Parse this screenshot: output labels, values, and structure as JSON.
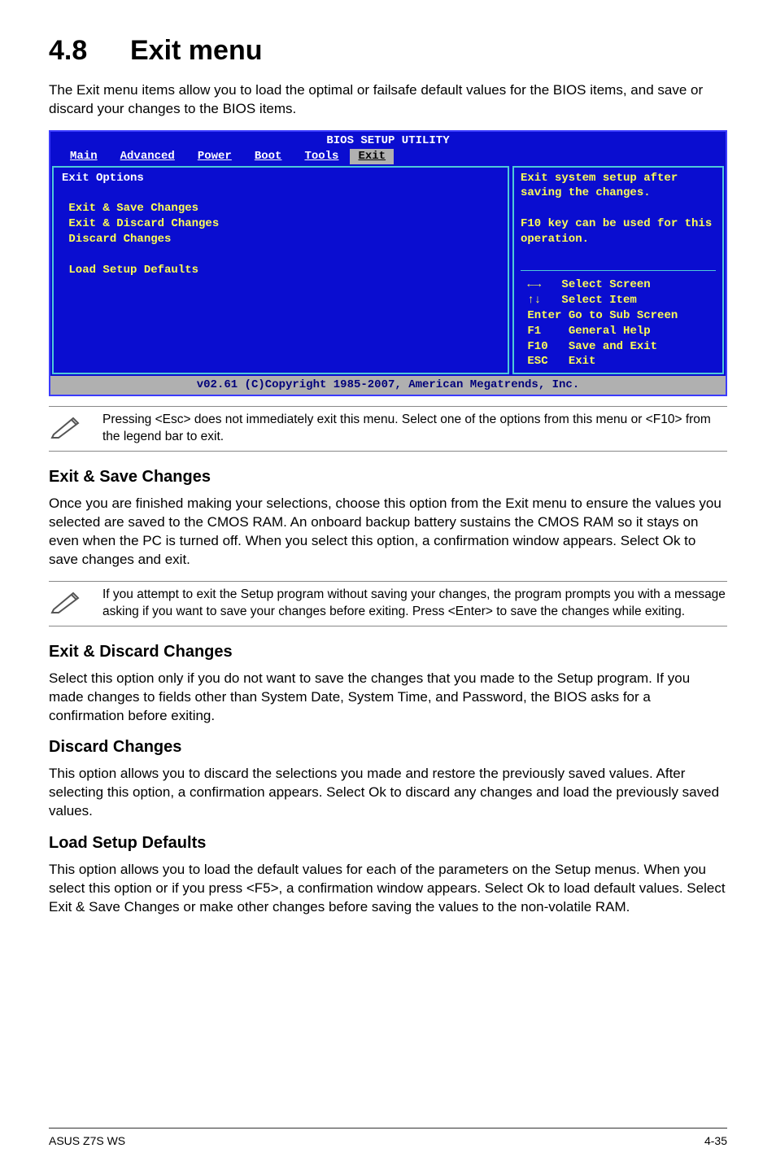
{
  "heading": {
    "number": "4.8",
    "title": "Exit menu"
  },
  "intro": "The Exit menu items allow you to load the optimal or failsafe default values for the BIOS items, and save or discard your changes to the BIOS items.",
  "bios": {
    "title": "BIOS SETUP UTILITY",
    "tabs": [
      "Main",
      "Advanced",
      "Power",
      "Boot",
      "Tools",
      "Exit"
    ],
    "active_tab": "Exit",
    "left": {
      "heading": "Exit Options",
      "items": [
        "Exit & Save Changes",
        "Exit & Discard Changes",
        "Discard Changes",
        "",
        "Load Setup Defaults"
      ]
    },
    "right": {
      "help1": "Exit system setup after saving the changes.",
      "help2": "F10 key can be used for this operation.",
      "hints": [
        {
          "key": "←→",
          "text": "Select Screen"
        },
        {
          "key": "↑↓",
          "text": "Select Item"
        },
        {
          "key": "Enter",
          "text": "Go to Sub Screen"
        },
        {
          "key": "F1",
          "text": "General Help"
        },
        {
          "key": "F10",
          "text": "Save and Exit"
        },
        {
          "key": "ESC",
          "text": "Exit"
        }
      ]
    },
    "footer": "v02.61 (C)Copyright 1985-2007, American Megatrends, Inc."
  },
  "note1": "Pressing <Esc> does not immediately exit this menu. Select one of the options from this menu or <F10> from the legend bar to exit.",
  "sections": {
    "s1": {
      "title": "Exit & Save Changes",
      "body": "Once you are finished making your selections, choose this option from the Exit menu to ensure the values you selected are saved to the CMOS RAM. An onboard backup battery sustains the CMOS RAM so it stays on even when the PC is turned off. When you select this option, a confirmation window appears. Select Ok to save changes and exit."
    },
    "note2": "If you attempt to exit the Setup program without saving your changes, the program prompts you with a message asking if you want to save your changes before exiting. Press <Enter> to save the changes while exiting.",
    "s2": {
      "title": "Exit & Discard Changes",
      "body": "Select this option only if you do not want to save the changes that you  made to the Setup program. If you made changes to fields other than System Date, System Time, and Password, the BIOS asks for a confirmation before exiting."
    },
    "s3": {
      "title": "Discard Changes",
      "body": "This option allows you to discard the selections you made and restore the previously saved values. After selecting this option, a confirmation appears. Select Ok to discard any changes and load the previously saved values."
    },
    "s4": {
      "title": "Load Setup Defaults",
      "body": "This option allows you to load the default values for each of the parameters on the Setup menus. When you select this option or if you press <F5>, a confirmation window appears. Select Ok to load default values. Select Exit & Save Changes or make other changes before saving the values to the non-volatile RAM."
    }
  },
  "footer": {
    "left": "ASUS Z7S WS",
    "right": "4-35"
  }
}
